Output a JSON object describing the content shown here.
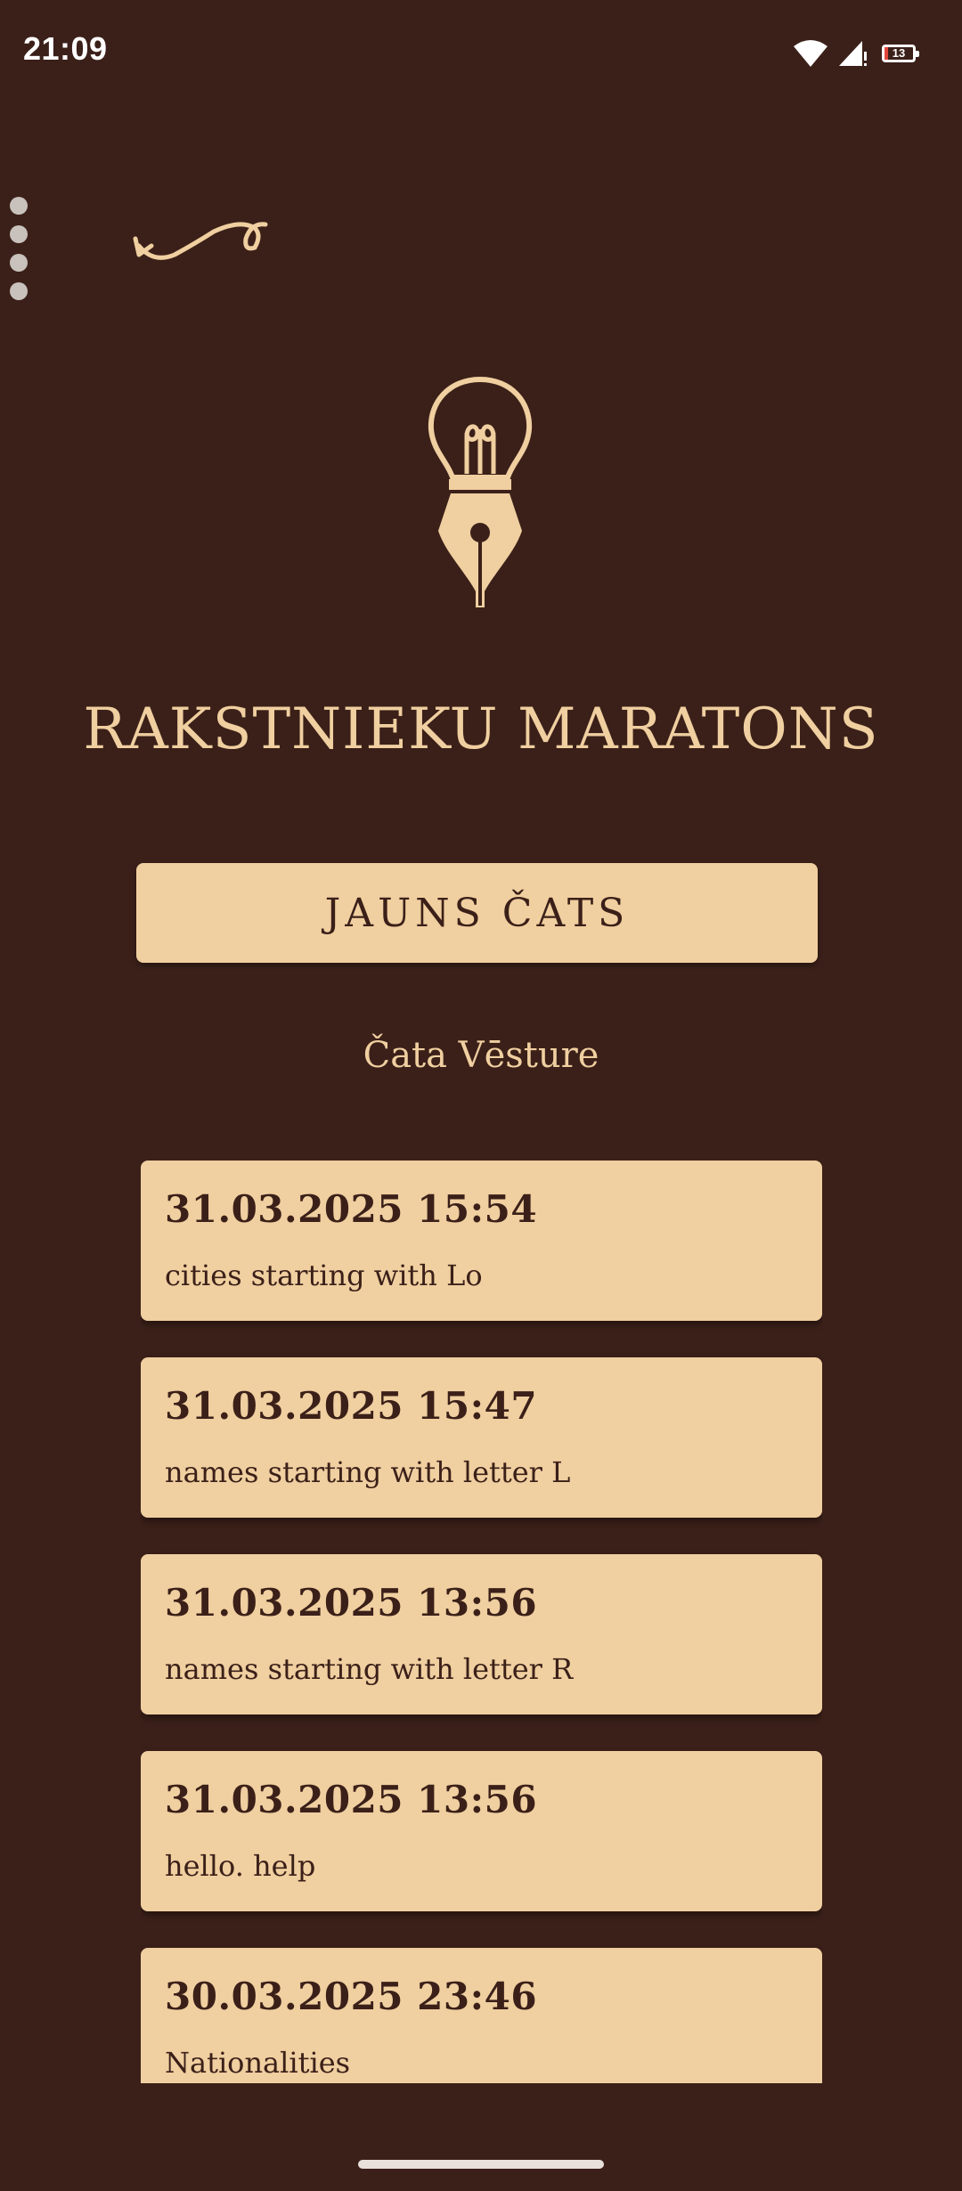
{
  "status_bar": {
    "time": "21:09",
    "battery_level": "13",
    "icons": [
      "wifi-icon",
      "cellular-signal-icon",
      "battery-icon"
    ]
  },
  "header": {
    "title": "RAKSTNIEKU MARATONS",
    "logo_icon": "lightbulb-pen-nib-icon",
    "back_icon": "curly-back-arrow-icon"
  },
  "actions": {
    "new_chat_label": "JAUNS ČATS"
  },
  "history": {
    "heading": "Čata Vēsture",
    "items": [
      {
        "date": "31.03.2025 15:54",
        "preview": "cities starting with Lo"
      },
      {
        "date": "31.03.2025 15:47",
        "preview": "names starting with letter L"
      },
      {
        "date": "31.03.2025 13:56",
        "preview": "names starting with letter R"
      },
      {
        "date": "31.03.2025 13:56",
        "preview": "hello. help"
      },
      {
        "date": "30.03.2025 23:46",
        "preview": "Nationalities"
      }
    ]
  },
  "colors": {
    "background": "#3b2019",
    "accent": "#f0cfa0",
    "text_dark": "#3b2019"
  }
}
